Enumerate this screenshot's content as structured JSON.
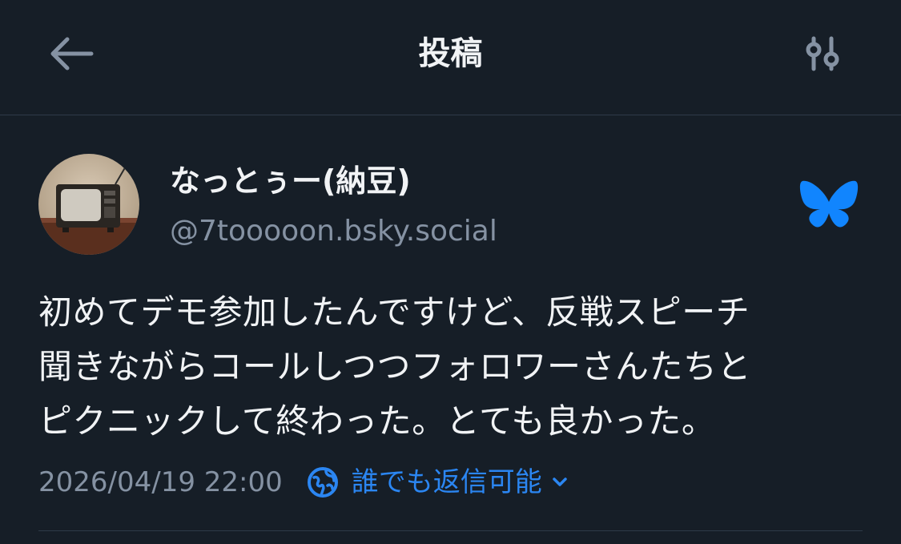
{
  "header": {
    "title": "投稿",
    "back_icon": "arrow-left-icon",
    "settings_icon": "sliders-icon"
  },
  "post": {
    "author": {
      "display_name": "なっとぅー(納豆)",
      "handle": "@7tooooon.bsky.social",
      "avatar": "vintage-tv-avatar"
    },
    "text": "初めてデモ参加したんですけど、反戦スピーチ\n聞きながらコールしつつフォロワーさんたちと\nピクニックして終わった。とても良かった。",
    "timestamp": "2026/04/19 22:00",
    "reply_setting": "誰でも返信可能"
  },
  "colors": {
    "background": "#161e27",
    "text_primary": "#f1f3f5",
    "text_secondary": "#8592a3",
    "accent": "#2b86f2",
    "divider": "#2e3a48",
    "butterfly": "#1185fe"
  }
}
